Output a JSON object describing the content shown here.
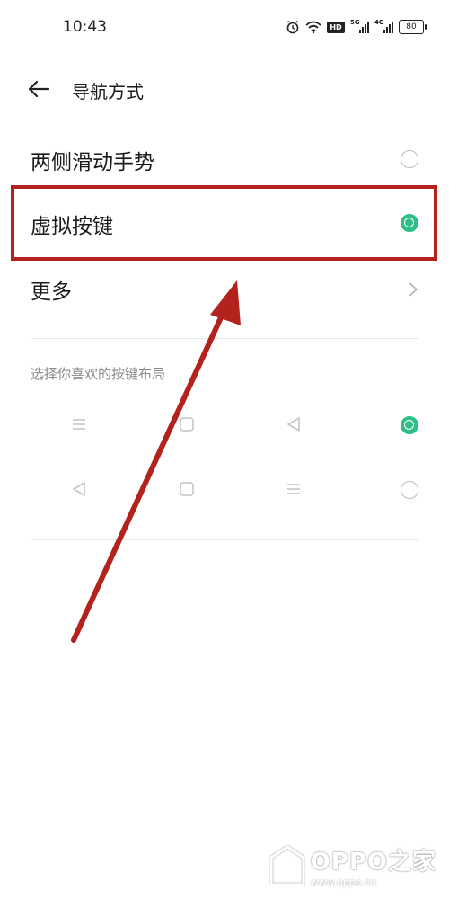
{
  "status_bar": {
    "time": "10:43",
    "battery": "80",
    "hd_label": "HD",
    "sig1_label": "5G",
    "sig2_label": "4G"
  },
  "header": {
    "title": "导航方式"
  },
  "options": [
    {
      "label": "两侧滑动手势",
      "selected": false
    },
    {
      "label": "虚拟按键",
      "selected": true
    },
    {
      "label": "更多"
    }
  ],
  "layout_section": {
    "title": "选择你喜欢的按键布局",
    "rows": [
      {
        "keys": [
          "menu-icon",
          "home-square-icon",
          "back-triangle-icon"
        ],
        "selected": true
      },
      {
        "keys": [
          "back-triangle-icon",
          "home-square-icon",
          "menu-icon"
        ],
        "selected": false
      }
    ]
  },
  "watermark": {
    "brand": "OPPO之家",
    "url": "www.oppo.cn"
  },
  "colors": {
    "accent": "#2fbf86",
    "highlight": "#b3221c",
    "arrow": "#b3221c"
  }
}
